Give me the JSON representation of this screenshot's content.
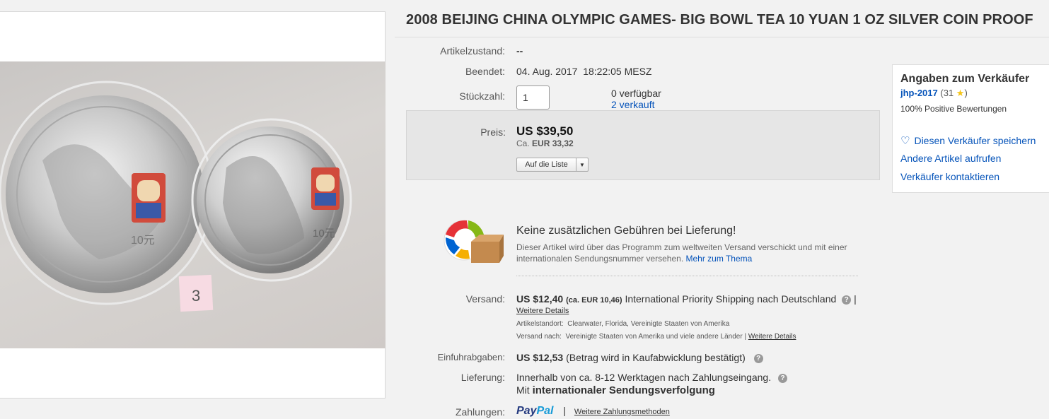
{
  "title": "2008 BEIJING CHINA OLYMPIC GAMES- BIG BOWL TEA 10 YUAN 1 OZ SILVER COIN PROOF",
  "photo": {
    "note_text": "3",
    "coin_value_text": "10元"
  },
  "condition": {
    "label": "Artikelzustand:",
    "value": "--"
  },
  "ended": {
    "label": "Beendet:",
    "value": "04. Aug. 2017  18:22:05 MESZ"
  },
  "quantity": {
    "label": "Stückzahl:",
    "value": "1",
    "available": "0 verfügbar",
    "sold": "2 verkauft"
  },
  "price": {
    "label": "Preis:",
    "main": "US $39,50",
    "converted_prefix": "Ca.",
    "converted_value": "EUR 33,32",
    "watch_label": "Auf die Liste"
  },
  "seller": {
    "title": "Angaben zum Verkäufer",
    "name": "jhp-2017",
    "score_open": "(31",
    "score_close": ")",
    "positive": "100% Positive Bewertungen",
    "save_label": "Diesen Verkäufer speichern",
    "other_items": "Andere Artikel aufrufen",
    "contact": "Verkäufer kontaktieren"
  },
  "promo": {
    "title": "Keine zusätzlichen Gebühren bei Lieferung!",
    "text": "Dieser Artikel wird über das Programm zum weltweiten Versand verschickt und mit einer internationalen Sendungsnummer versehen.",
    "link": "Mehr zum Thema"
  },
  "shipping": {
    "label": "Versand:",
    "price": "US $12,40",
    "converted": "(ca. EUR 10,46)",
    "service": "International Priority Shipping nach Deutschland",
    "separator": "|",
    "details_link": "Weitere Details",
    "location_label": "Artikelstandort:",
    "location_value": "Clearwater, Florida, Vereinigte Staaten von Amerika",
    "ship_to_label": "Versand nach:",
    "ship_to_value": "Vereinigte Staaten von Amerika und viele andere Länder",
    "ship_to_link": "Weitere Details"
  },
  "import": {
    "label": "Einfuhrabgaben:",
    "price": "US $12,53",
    "note": "(Betrag wird in Kaufabwicklung bestätigt)"
  },
  "delivery": {
    "label": "Lieferung:",
    "text": "Innerhalb von ca. 8-12 Werktagen nach Zahlungseingang.",
    "tracking_prefix": "Mit",
    "tracking_bold": "internationaler Sendungsverfolgung"
  },
  "payments": {
    "label": "Zahlungen:",
    "paypal": "PayPal",
    "separator": "|",
    "more_link": "Weitere Zahlungsmethoden"
  },
  "colors": {
    "link": "#0654ba",
    "star": "#f5c518",
    "paypal_dark": "#253b80",
    "paypal_light": "#179bd7"
  }
}
